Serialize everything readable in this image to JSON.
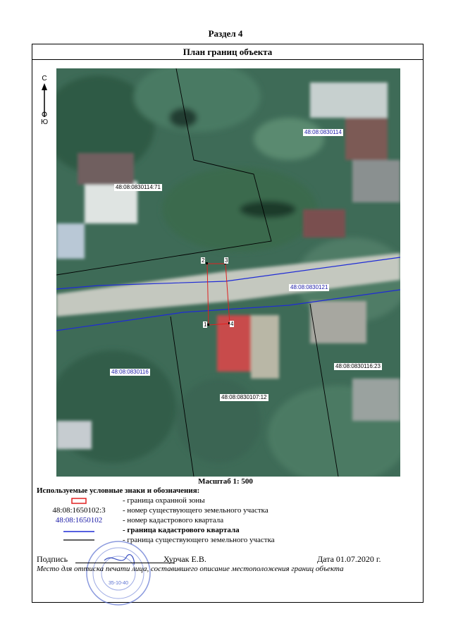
{
  "section": "Раздел 4",
  "header": "План границ объекта",
  "compass": {
    "north": "С",
    "south": "Ю"
  },
  "map_labels": {
    "q114": "48:08:0830114",
    "p114_71": "48:08:0830114:71",
    "q121": "48:08:0830121",
    "q116": "48:08:0830116",
    "p116_23": "48:08:0830116:23",
    "p107_12": "48:08:0830107:12"
  },
  "points": {
    "p1": "1",
    "p2": "2",
    "p3": "3",
    "p4": "4"
  },
  "scale": "Масштаб 1: 500",
  "legend": {
    "title": "Используемые условные знаки и обозначения:",
    "items": [
      {
        "symbol": "",
        "text": "- граница  охранной зоны"
      },
      {
        "symbol": "48:08:1650102:3",
        "text": "- номер существующего земельного участка"
      },
      {
        "symbol": "48:08:1650102",
        "text": "- номер кадастрового квартала"
      },
      {
        "symbol": "",
        "text": "- граница кадастрового квартала"
      },
      {
        "symbol": "",
        "text": "- граница существующего земельного участка"
      }
    ]
  },
  "signature": {
    "label": "Подпись",
    "name": "Хурчак Е.В.",
    "date": "Дата 01.07.2020 г.",
    "note": "Место для оттиска печати лица, составившего описание местоположения границ объекта"
  },
  "stamp": {
    "number": "35-10-40"
  },
  "colors": {
    "zone_boundary": "#e02020",
    "quarter_boundary": "#1f2bd6",
    "parcel_boundary": "#000000",
    "quarter_label": "#1a1aa6"
  }
}
